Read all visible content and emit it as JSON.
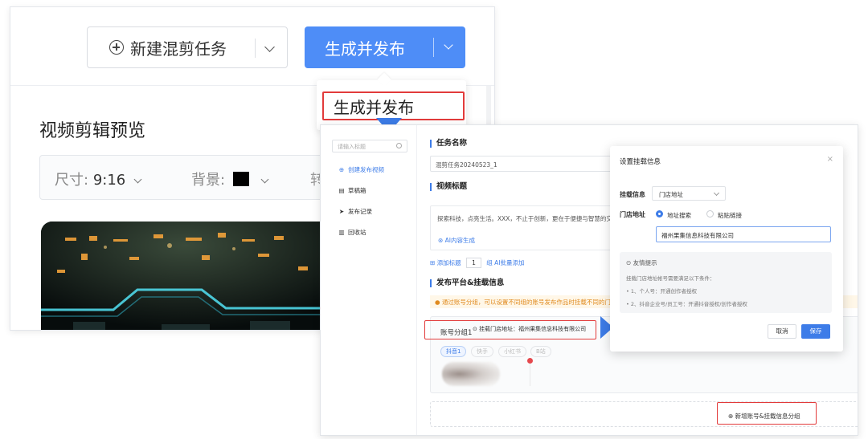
{
  "editor": {
    "new_task_label": "新建混剪任务",
    "publish_label": "生成并发布",
    "preview_title": "视频剪辑预览",
    "size_label": "尺寸:",
    "size_value": "9:16",
    "background_label": "背景:",
    "more_label": "转"
  },
  "dropdown": {
    "item": "生成并发布"
  },
  "publish_page": {
    "search_placeholder": "请输入标题",
    "nav": [
      {
        "label": "创建发布视频",
        "icon": "plus-circle-icon"
      },
      {
        "label": "草稿箱",
        "icon": "draft-icon"
      },
      {
        "label": "发布记录",
        "icon": "send-icon"
      },
      {
        "label": "回收站",
        "icon": "trash-icon"
      }
    ],
    "task_name_title": "任务名称",
    "task_name_value": "混剪任务20240523_1",
    "video_title_title": "视频标题",
    "video_title_text": "探索科技，点亮生活。XXX，不止于创新，更在于便捷与智慧的交融。",
    "ai_generate": "AI内容生成",
    "add_tag_label": "添加标题",
    "add_tag_count": "1",
    "batch_add": "组   AI批量添加",
    "platform_title": "发布平台&挂载信息",
    "warning": "通过账号分组，可以设置不同组的账号发布作品时挂载不同的门店地址，有效提升门店曝光，多个分组可同时设置",
    "group_label": "账号分组1",
    "group_store": "挂载门店地址：福州果集信息科技有限公司",
    "platforms": [
      "抖音1",
      "快手",
      "小红书",
      "B站"
    ],
    "add_group": "新增账号&挂载信息分组"
  },
  "modal": {
    "title": "设置挂载信息",
    "close": "×",
    "mount_label": "挂载信息",
    "mount_value": "门店地址",
    "store_label": "门店地址",
    "radio_search": "地址搜索",
    "radio_paste": "粘贴链接",
    "store_value": "福州果集信息科技有限公司",
    "tip_title": "友情提示",
    "tip_intro": "挂载门店地址帐号需要满足以下条件：",
    "tips": [
      "1、个人号：开通创作者授权",
      "2、抖音企业号/员工号：开通抖音授权/创作者授权"
    ],
    "cancel": "取消",
    "save": "保存"
  },
  "colors": {
    "primary": "#4e8df7",
    "highlight": "#e23b3b",
    "warning": "#e08a1e"
  }
}
